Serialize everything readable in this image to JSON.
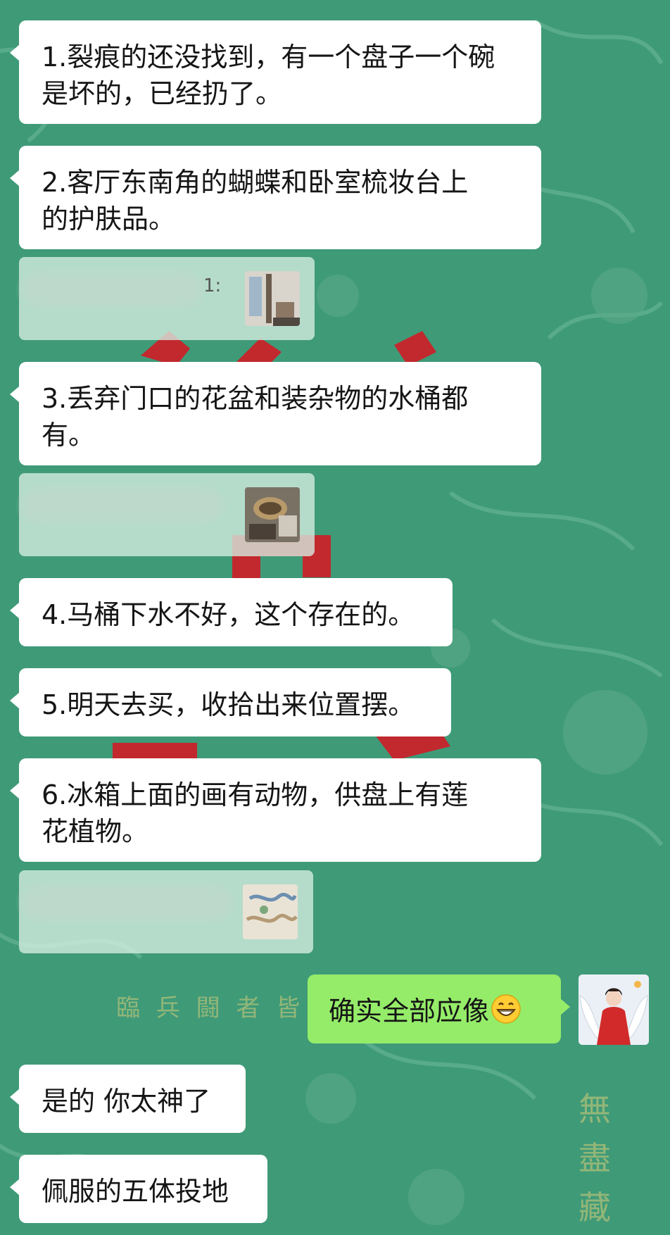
{
  "background": {
    "color": "#3f9a78",
    "bottom_line": "臨 兵 闘 者 皆",
    "vertical_line": "無盡藏"
  },
  "messages": [
    {
      "side": "received",
      "text_line1": "1.裂痕的还没找到，有一个盘子一个碗",
      "text_line2": "是坏的，已经扔了。"
    },
    {
      "side": "received",
      "text_line1": "2.客厅东南角的蝴蝶和卧室梳妆台上",
      "text_line2": "的护肤品。"
    },
    {
      "side": "received",
      "type": "quote",
      "colon": "1:",
      "thumb": "room-corner-photo"
    },
    {
      "side": "received",
      "text_line1": "3.丢弃门口的花盆和装杂物的水桶都",
      "text_line2": "有。"
    },
    {
      "side": "received",
      "type": "quote",
      "thumb": "flowerpot-photo"
    },
    {
      "side": "received",
      "text": "4.马桶下水不好，这个存在的。"
    },
    {
      "side": "received",
      "text": "5.明天去买，收拾出来位置摆。"
    },
    {
      "side": "received",
      "text_line1": "6.冰箱上面的画有动物，供盘上有莲",
      "text_line2": "花植物。"
    },
    {
      "side": "received",
      "type": "quote",
      "thumb": "painting-photo"
    },
    {
      "side": "sent",
      "text": "确实全部应像",
      "emoji": "grinning-face-icon"
    },
    {
      "side": "received",
      "text": "是的 你太神了"
    },
    {
      "side": "received",
      "text": "佩服的五体投地"
    }
  ],
  "colors": {
    "received_bubble": "#ffffff",
    "sent_bubble": "#95ec69"
  }
}
